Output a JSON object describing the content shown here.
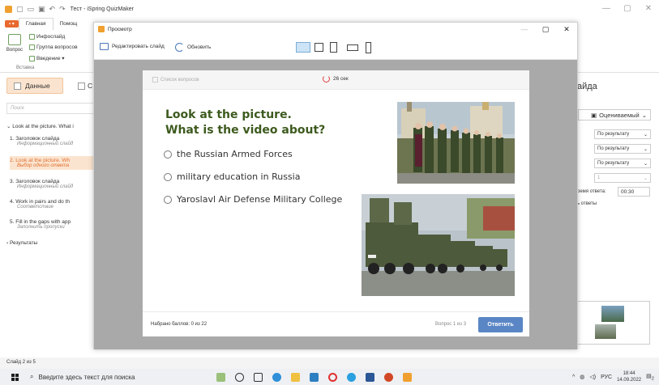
{
  "app": {
    "title": "Тест - iSpring QuizMaker",
    "window_controls": [
      "—",
      "▢",
      "✕"
    ]
  },
  "ribbon": {
    "file_tab": "▪ ▾",
    "tabs": [
      "Главная",
      "Помощ"
    ],
    "group_label": "Вставка",
    "question_button": "Вопрос",
    "items": [
      "Инфослайд",
      "Группа вопросов",
      "Введение ▾"
    ]
  },
  "left_panel": {
    "tab_data": "Данные",
    "tab_other": "С",
    "search_placeholder": "Поиск",
    "root": "Look at the picture. What i",
    "items": [
      {
        "title": "1. Заголовок слайда",
        "sub": "Информационный слайд"
      },
      {
        "title": "2. Look at the picture. Wh",
        "sub": "Выбор одного ответа"
      },
      {
        "title": "3. Заголовок слайда",
        "sub": "Информационный слайд"
      },
      {
        "title": "4. Work in pairs and do th",
        "sub": "Соответствие"
      },
      {
        "title": "5. Fill in the gaps with app",
        "sub": "Заполнить пропуски"
      }
    ],
    "results": "Результаты"
  },
  "right_panel": {
    "title": "айда",
    "grading": "Оцениваемый",
    "dropdowns": [
      "По результату",
      "По результату",
      "По результату",
      "1"
    ],
    "time_label": "ремя ответа:",
    "time_value": "00:30",
    "answers_label": "ь ответы"
  },
  "status_bar": {
    "text": "Слайд 2 из 5"
  },
  "taskbar": {
    "search_text": "Введите здесь текст для поиска",
    "language": "РУС",
    "time": "18:44",
    "date": "14.09.2022",
    "notification_count": "2"
  },
  "preview": {
    "title": "Просмотр",
    "edit_slide": "Редактировать слайд",
    "refresh": "Обновить",
    "question_list": "Список вопросов",
    "timer": "26 сек",
    "question_line1": "Look at the picture.",
    "question_line2": "What is the video about?",
    "options": [
      "the Russian Armed Forces",
      "military education in Russia",
      "Yaroslavl Air Defense Military College"
    ],
    "score": "Набрано баллов: 0 из 22",
    "question_counter": "Вопрос 1 из 3",
    "answer_button": "Ответить"
  },
  "colors": {
    "accent_orange": "#e8692c",
    "selected_bg": "#fbe4cf",
    "question_green": "#3d5a1e",
    "answer_blue": "#5a86c5"
  }
}
